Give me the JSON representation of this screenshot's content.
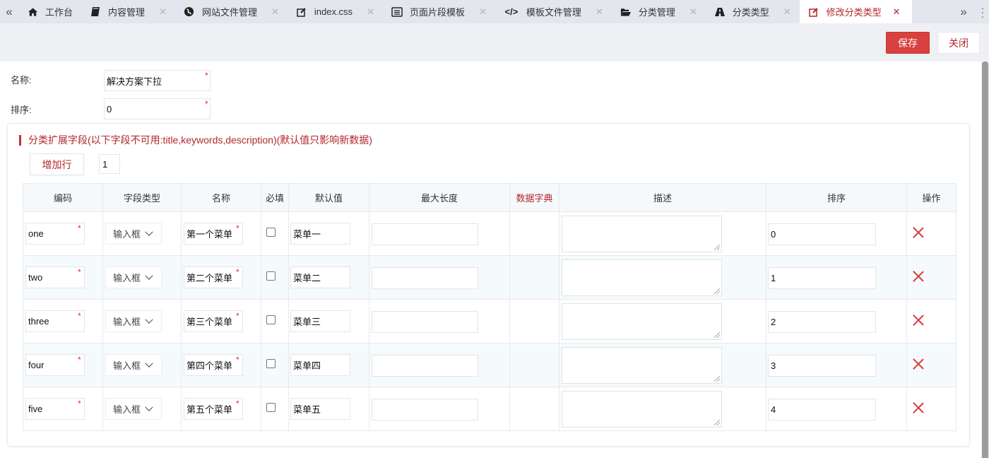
{
  "tabs": [
    {
      "label": "工作台",
      "icon": "home-icon",
      "closable": false,
      "active": false
    },
    {
      "label": "内容管理",
      "icon": "book-icon",
      "closable": true,
      "active": false
    },
    {
      "label": "网站文件管理",
      "icon": "globe-icon",
      "closable": true,
      "active": false
    },
    {
      "label": "index.css",
      "icon": "edit-icon",
      "closable": true,
      "active": false
    },
    {
      "label": "页面片段模板",
      "icon": "list-icon",
      "closable": true,
      "active": false
    },
    {
      "label": "模板文件管理",
      "icon": "code-icon",
      "closable": true,
      "active": false
    },
    {
      "label": "分类管理",
      "icon": "folder-open-icon",
      "closable": true,
      "active": false
    },
    {
      "label": "分类类型",
      "icon": "road-icon",
      "closable": true,
      "active": false
    },
    {
      "label": "修改分类类型",
      "icon": "edit-icon",
      "closable": true,
      "active": true
    }
  ],
  "toolbar": {
    "save_label": "保存",
    "close_label": "关闭"
  },
  "form": {
    "name_label": "名称:",
    "name_value": "解决方案下拉",
    "sort_label": "排序:",
    "sort_value": "0"
  },
  "panel": {
    "title": "分类扩展字段(以下字段不可用:title,keywords,description)(默认值只影响新数据)",
    "add_row_label": "增加行",
    "row_count": "1"
  },
  "table": {
    "headers": [
      "编码",
      "字段类型",
      "名称",
      "必填",
      "默认值",
      "最大长度",
      "数据字典",
      "描述",
      "排序",
      "操作"
    ],
    "rows": [
      {
        "code": "one",
        "type": "输入框",
        "name": "第一个菜单",
        "required": false,
        "default": "菜单一",
        "max_length": "",
        "description": "",
        "sort": "0"
      },
      {
        "code": "two",
        "type": "输入框",
        "name": "第二个菜单",
        "required": false,
        "default": "菜单二",
        "max_length": "",
        "description": "",
        "sort": "1"
      },
      {
        "code": "three",
        "type": "输入框",
        "name": "第三个菜单",
        "required": false,
        "default": "菜单三",
        "max_length": "",
        "description": "",
        "sort": "2"
      },
      {
        "code": "four",
        "type": "输入框",
        "name": "第四个菜单",
        "required": false,
        "default": "菜单四",
        "max_length": "",
        "description": "",
        "sort": "3"
      },
      {
        "code": "five",
        "type": "输入框",
        "name": "第五个菜单",
        "required": false,
        "default": "菜单五",
        "max_length": "",
        "description": "",
        "sort": "4"
      }
    ]
  },
  "colors": {
    "accent": "#b3262b",
    "save_button": "#d9403e",
    "required_mark": "#e0302f"
  }
}
